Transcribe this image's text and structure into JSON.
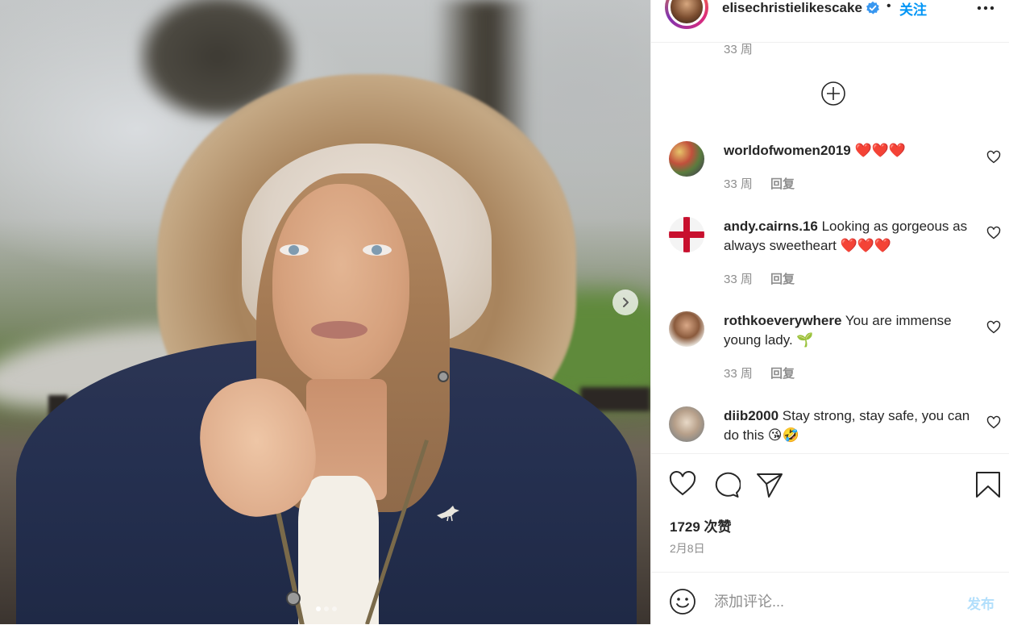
{
  "post": {
    "username": "elisechristielikescake",
    "bullet": "•",
    "follow_label": "关注",
    "verified_icon": "verified-badge-icon",
    "more_icon": "more-options-icon"
  },
  "carousel": {
    "total": 3,
    "active_index": 0,
    "next_icon": "chevron-right-icon"
  },
  "comments": {
    "previous_meta": {
      "time": "33 周"
    },
    "load_more_icon": "plus-circle-icon",
    "items": [
      {
        "username": "worldofwomen2019",
        "text": "❤️❤️❤️",
        "time": "33 周",
        "reply_label": "回复"
      },
      {
        "username": "andy.cairns.16",
        "text": "Looking as gorgeous as always sweetheart ❤️❤️❤️",
        "time": "33 周",
        "reply_label": "回复"
      },
      {
        "username": "rothkoeverywhere",
        "text": "You are immense young lady. 🌱",
        "time": "33 周",
        "reply_label": "回复"
      },
      {
        "username": "diib2000",
        "text": "Stay strong, stay safe, you can do this 😘🤣",
        "time": "",
        "reply_label": ""
      }
    ]
  },
  "actions": {
    "like_icon": "heart-icon",
    "comment_icon": "comment-bubble-icon",
    "share_icon": "paper-plane-icon",
    "save_icon": "bookmark-icon",
    "likes_text": "1729 次赞",
    "date_text": "2月8日"
  },
  "comment_box": {
    "emoji_icon": "emoji-smile-icon",
    "placeholder": "添加评论...",
    "value": "",
    "post_label": "发布"
  },
  "colors": {
    "accent": "#0095f6",
    "post_disabled": "#b2dffc",
    "muted_text": "#8e8e8e",
    "text": "#262626",
    "heart_red": "#e0161f"
  }
}
